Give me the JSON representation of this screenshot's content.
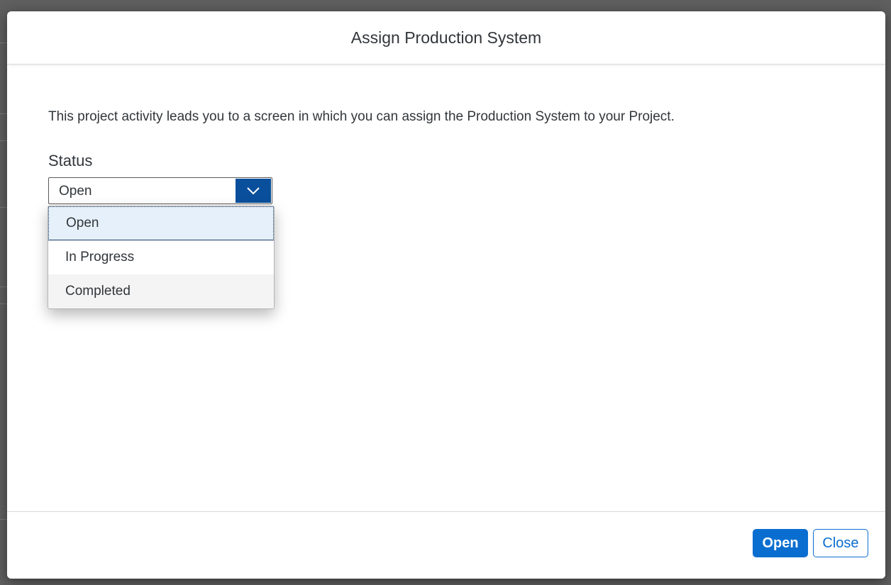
{
  "dialog": {
    "title": "Assign Production System",
    "description": "This project activity leads you to a screen in which you can assign the Production System to your Project.",
    "status_label": "Status",
    "status_select": {
      "selected_value": "Open",
      "options": [
        "Open",
        "In Progress",
        "Completed"
      ],
      "highlighted_option": "Open"
    },
    "footer": {
      "open_label": "Open",
      "close_label": "Close"
    }
  },
  "colors": {
    "primary": "#0a6ed1",
    "select_arrow_bg": "#0a4f9c",
    "highlight_bg": "#e5f0fa",
    "text": "#32363a"
  },
  "icons": {
    "select_arrow": "chevron-down-icon"
  }
}
